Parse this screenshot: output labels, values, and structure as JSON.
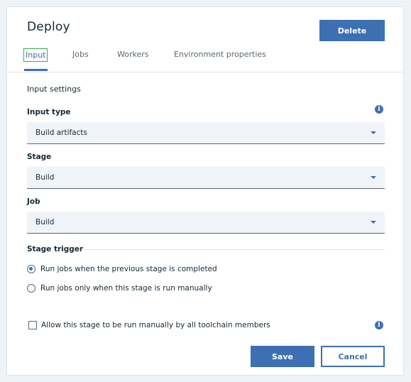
{
  "header": {
    "title": "Deploy",
    "delete_label": "Delete"
  },
  "tabs": [
    {
      "label": "Input",
      "active": true
    },
    {
      "label": "Jobs",
      "active": false
    },
    {
      "label": "Workers",
      "active": false
    },
    {
      "label": "Environment properties",
      "active": false
    }
  ],
  "input_settings": {
    "section_title": "Input settings",
    "input_type": {
      "label": "Input type",
      "value": "Build artifacts",
      "info_icon": "info-icon"
    },
    "stage": {
      "label": "Stage",
      "value": "Build"
    },
    "job": {
      "label": "Job",
      "value": "Build"
    }
  },
  "stage_trigger": {
    "title": "Stage trigger",
    "options": [
      {
        "label": "Run jobs when the previous stage is completed",
        "selected": true
      },
      {
        "label": "Run jobs only when this stage is run manually",
        "selected": false
      }
    ]
  },
  "manual_permission": {
    "label": "Allow this stage to be run manually by all toolchain members",
    "checked": false,
    "info_icon": "info-icon"
  },
  "footer": {
    "save_label": "Save",
    "cancel_label": "Cancel"
  },
  "colors": {
    "primary": "#3d70b2",
    "focus_outline": "#2cb34b",
    "field_background": "#f0f4f8",
    "text": "#152935"
  }
}
